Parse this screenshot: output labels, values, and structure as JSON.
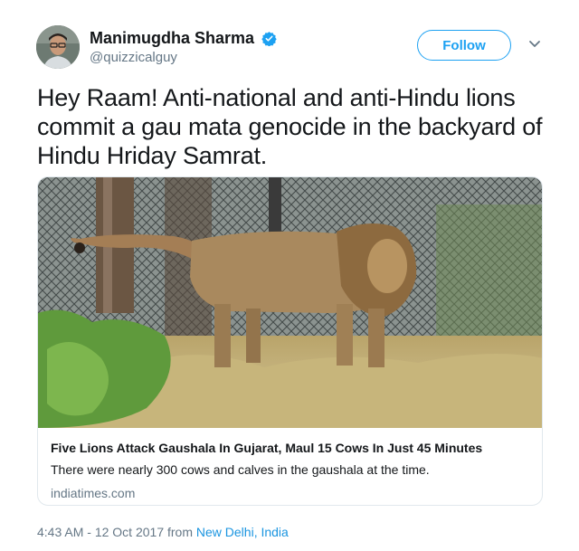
{
  "author": {
    "display_name": "Manimugdha Sharma",
    "handle": "@quizzicalguy",
    "verified": true
  },
  "follow_button": {
    "label": "Follow"
  },
  "tweet": {
    "text": "Hey Raam! Anti-national and anti-Hindu lions commit a gau mata genocide in the backyard of Hindu Hriday Samrat."
  },
  "card": {
    "image_subject": "lion in grass enclosure",
    "title": "Five Lions Attack Gaushala In Gujarat, Maul 15 Cows In Just 45 Minutes",
    "description": "There were nearly 300 cows and calves in the gaushala at the time.",
    "domain": "indiatimes.com"
  },
  "meta": {
    "time": "4:43 AM",
    "separator": " - ",
    "date": "12 Oct 2017",
    "from_text": " from ",
    "location": "New Delhi, India"
  },
  "colors": {
    "accent": "#1da1f2",
    "text": "#14171a",
    "secondary": "#657786",
    "border": "#e1e8ed"
  }
}
